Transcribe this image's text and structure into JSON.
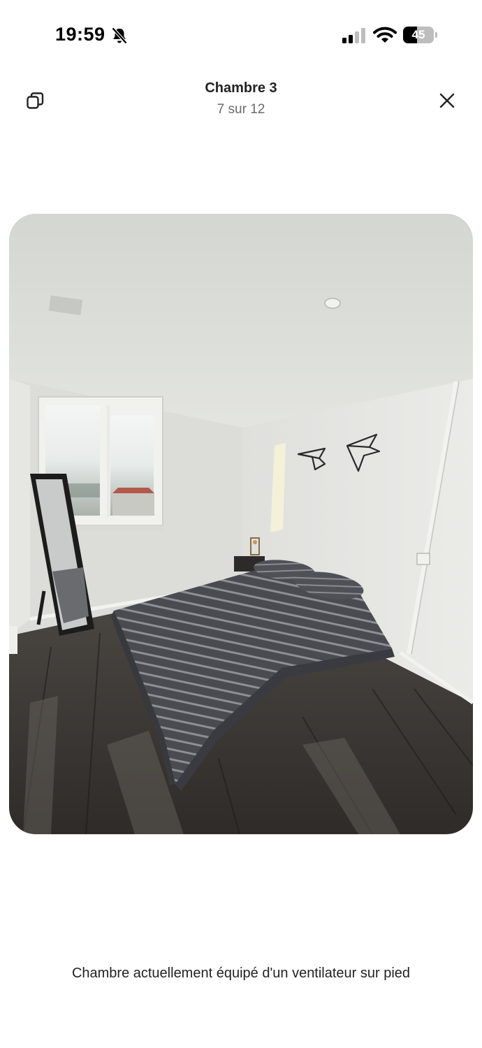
{
  "status_bar": {
    "time": "19:59",
    "battery": "45",
    "battery_level": 0.45
  },
  "header": {
    "title": "Chambre 3",
    "counter": "7 sur 12"
  },
  "photo": {
    "caption": "Chambre actuellement équipé d'un ventilateur sur pied"
  },
  "icons": {
    "bell": "bell-slash-icon",
    "signal": "cellular-signal-icon",
    "wifi": "wifi-icon",
    "battery": "battery-icon",
    "copy": "copy-icon",
    "close": "close-icon"
  }
}
